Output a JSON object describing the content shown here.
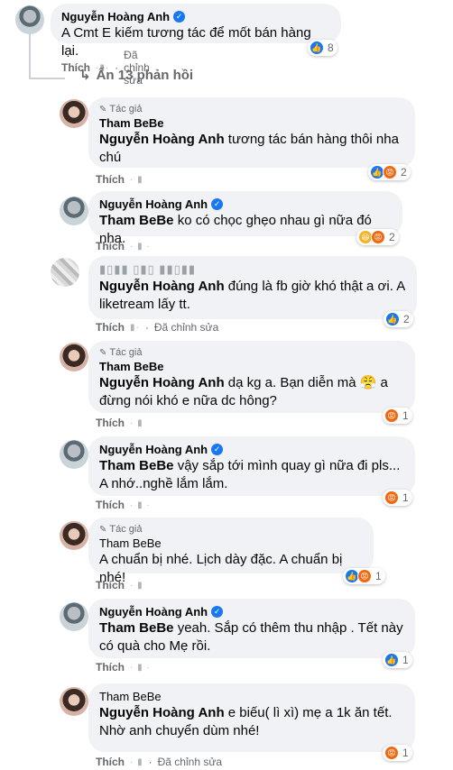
{
  "main_comment": {
    "author": "Nguyễn Hoàng Anh",
    "text": "A Cmt E kiếm tương tác để mốt bán hàng lại.",
    "like_label": "Thích",
    "edited": "Đã chỉnh sửa",
    "reaction_count": "8"
  },
  "replies_toggle": "Ẩn 13 phản hồi",
  "author_badge": "Tác giả",
  "replies": [
    {
      "author": "Tham BeBe",
      "mention": "Nguyễn Hoàng Anh",
      "text": " tương tác bán hàng thôi nha chú",
      "like_label": "Thích",
      "reaction_count": "2"
    },
    {
      "author": "Nguyễn Hoàng Anh",
      "mention": "Tham BeBe",
      "text": " ko có chọc ghẹo nhau gì nữa đó nha.",
      "like_label": "Thích",
      "reaction_count": "2"
    },
    {
      "mention": "Nguyễn Hoàng Anh",
      "text": " đúng là fb giờ khó thật a ơi. A liketream lấy tt.",
      "like_label": "Thích",
      "edited": "Đã chỉnh sửa",
      "reaction_count": "2"
    },
    {
      "author": "Tham BeBe",
      "mention": "Nguyễn Hoàng Anh",
      "text": " dạ kg a. Bạn diễn mà 😤 a đừng nói khó e nữa dc hông?",
      "like_label": "Thích",
      "reaction_count": "1"
    },
    {
      "author": "Nguyễn Hoàng Anh",
      "mention": "Tham BeBe",
      "text": " vậy sắp tới mình quay gì nữa đi pls... A nhớ..nghề lắm lắm.",
      "like_label": "Thích",
      "reaction_count": "1"
    },
    {
      "author": "Tham BeBe",
      "text": "A chuẩn bị nhé. Lịch dày đặc. A chuẩn bị nhé!",
      "like_label": "Thích",
      "reaction_count": "1"
    },
    {
      "author": "Nguyễn Hoàng Anh",
      "mention": "Tham BeBe",
      "text": " yeah. Sắp có thêm thu nhập . Tết này có quà cho Mẹ rồi.",
      "like_label": "Thích",
      "reaction_count": "1"
    },
    {
      "author": "Tham BeBe",
      "mention": "Nguyễn Hoàng Anh",
      "text": " e biếu( lì xì) mẹ a 1k ăn tết. Nhờ anh chuyển dùm nhé!",
      "like_label": "Thích",
      "edited": "Đã chỉnh sửa",
      "reaction_count": "1"
    }
  ],
  "colors": {
    "like": "#1877f2",
    "angry": "#f2680f",
    "bubble": "#f0f2f5",
    "verified": "#1877f2"
  }
}
